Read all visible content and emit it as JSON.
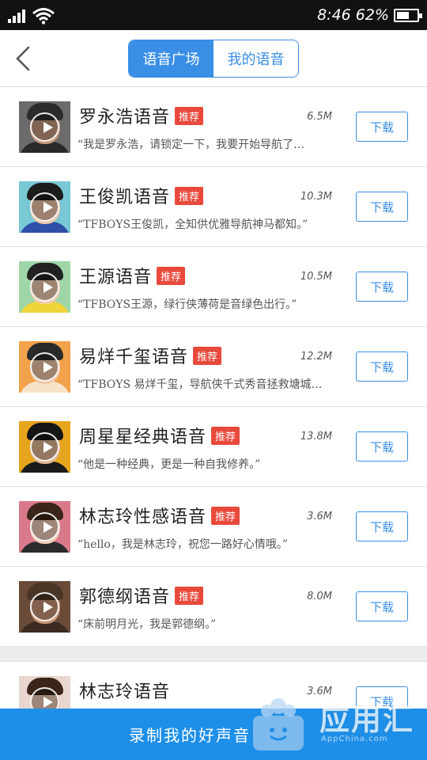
{
  "status_bar": {
    "time": "8:46",
    "battery_text": "62%",
    "battery_level": 0.62
  },
  "header": {
    "tabs": [
      {
        "label": "语音广场",
        "active": true
      },
      {
        "label": "我的语音",
        "active": false
      }
    ]
  },
  "colors": {
    "accent": "#3a8ee6",
    "badge": "#e8493a",
    "bottom_bar": "#1e8fe8"
  },
  "download_label": "下载",
  "items": [
    {
      "name": "罗永浩语音",
      "badge": "推荐",
      "size": "6.5M",
      "desc": "“我是罗永浩，请锁定一下，我要开始导航了…",
      "avatar": {
        "bg": "#6b6b6b",
        "skin": "#c79a7e",
        "hair": "#2b2b2b",
        "clothes": "#2a2a2a"
      }
    },
    {
      "name": "王俊凯语音",
      "badge": "推荐",
      "size": "10.3M",
      "desc": "“TFBOYS王俊凯，全知供优雅导航神马都知。”",
      "avatar": {
        "bg": "#79c8d6",
        "skin": "#f0c8aa",
        "hair": "#1c1c1c",
        "clothes": "#2f4fa8"
      }
    },
    {
      "name": "王源语音",
      "badge": "推荐",
      "size": "10.5M",
      "desc": "“TFBOYS王源，绿行侠薄荷是音绿色出行。”",
      "avatar": {
        "bg": "#9fd6a8",
        "skin": "#f3cdb0",
        "hair": "#222222",
        "clothes": "#f0d53a"
      }
    },
    {
      "name": "易烊千玺语音",
      "badge": "推荐",
      "size": "12.2M",
      "desc": "“TFBOYS 易烊千玺，导航侠千式秀音拯救塘城…",
      "avatar": {
        "bg": "#f2a24a",
        "skin": "#f1c9a9",
        "hair": "#2a2a2a",
        "clothes": "#f7e3c8"
      }
    },
    {
      "name": "周星星经典语音",
      "badge": "推荐",
      "size": "13.8M",
      "desc": "“他是一种经典，更是一种自我修养。”",
      "avatar": {
        "bg": "#e6a51c",
        "skin": "#e4b894",
        "hair": "#151515",
        "clothes": "#1a1a1a"
      }
    },
    {
      "name": "林志玲性感语音",
      "badge": "推荐",
      "size": "3.6M",
      "desc": "“hello，我是林志玲，祝您一路好心情哦。”",
      "avatar": {
        "bg": "#d87a8a",
        "skin": "#f2cdb7",
        "hair": "#3b2418",
        "clothes": "#2b2b2b"
      }
    },
    {
      "name": "郭德纲语音",
      "badge": "推荐",
      "size": "8.0M",
      "desc": "“床前明月光，我是郭德纲。”",
      "avatar": {
        "bg": "#6a4b38",
        "skin": "#c99676",
        "hair": "#4a3526",
        "clothes": "#3a2a20"
      }
    }
  ],
  "extra_items": [
    {
      "name": "林志玲语音",
      "size": "3.6M",
      "avatar": {
        "bg": "#e9d6cf",
        "skin": "#f2cdb7",
        "hair": "#3b2418",
        "clothes": "#c7a59a"
      }
    }
  ],
  "bottom_bar": {
    "label": "录制我的好声音"
  },
  "watermark": {
    "text": "应用汇",
    "url": "AppChina.com"
  }
}
